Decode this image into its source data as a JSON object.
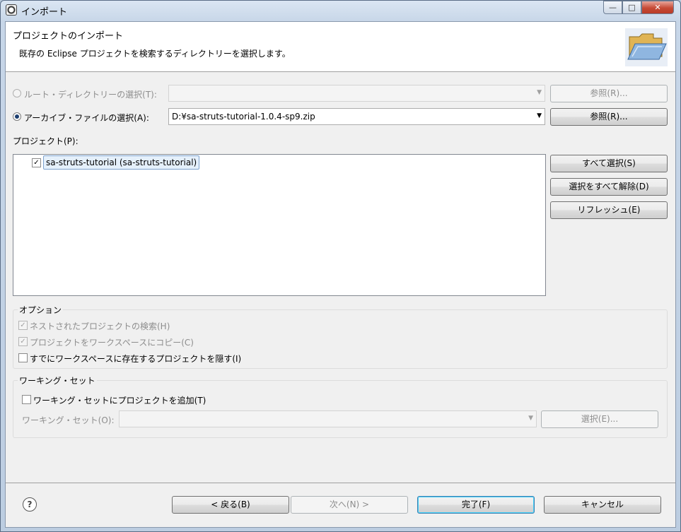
{
  "window": {
    "title": "インポート",
    "icon": "eclipse-icon",
    "controls": {
      "minimize": "—",
      "maximize": "□",
      "close": "✕"
    }
  },
  "header": {
    "title": "プロジェクトのインポート",
    "description": "既存の Eclipse プロジェクトを検索するディレクトリーを選択します。",
    "icon": "open-folder-icon"
  },
  "source": {
    "root_dir": {
      "label": "ルート・ディレクトリーの選択(T):",
      "value": "",
      "selected": false,
      "browse_label": "参照(R)..."
    },
    "archive": {
      "label": "アーカイブ・ファイルの選択(A):",
      "value": "D:¥sa-struts-tutorial-1.0.4-sp9.zip",
      "selected": true,
      "browse_label": "参照(R)..."
    }
  },
  "projects": {
    "label": "プロジェクト(P):",
    "items": [
      {
        "label": "sa-struts-tutorial (sa-struts-tutorial)",
        "checked": true
      }
    ],
    "buttons": {
      "select_all": "すべて選択(S)",
      "deselect_all": "選択をすべて解除(D)",
      "refresh": "リフレッシュ(E)"
    }
  },
  "options": {
    "title": "オプション",
    "search_nested": {
      "label": "ネストされたプロジェクトの検索(H)",
      "checked": true,
      "enabled": false
    },
    "copy_to_workspace": {
      "label": "プロジェクトをワークスペースにコピー(C)",
      "checked": true,
      "enabled": false
    },
    "hide_existing": {
      "label": "すでにワークスペースに存在するプロジェクトを隠す(I)",
      "checked": false,
      "enabled": true
    }
  },
  "working_sets": {
    "title": "ワーキング・セット",
    "add_label": "ワーキング・セットにプロジェクトを追加(T)",
    "add_checked": false,
    "field_label": "ワーキング・セット(O):",
    "field_value": "",
    "select_label": "選択(E)..."
  },
  "footer": {
    "help": "?",
    "back": "< 戻る(B)",
    "next": "次へ(N) >",
    "finish": "完了(F)",
    "cancel": "キャンセル"
  }
}
